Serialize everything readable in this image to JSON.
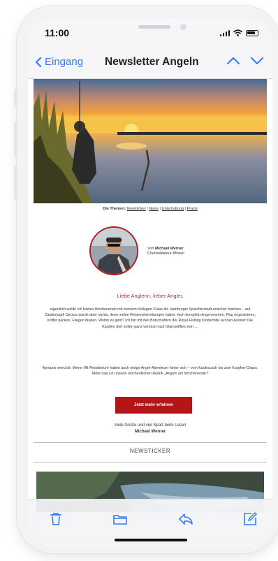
{
  "status": {
    "time": "11:00"
  },
  "nav": {
    "back_label": "Eingang",
    "title": "Newsletter Angeln"
  },
  "mail": {
    "topics": {
      "prefix": "Die Themen:",
      "links": [
        "Newsticker",
        "News",
        "Unterhaltung",
        "Praxis"
      ],
      "separator": " | "
    },
    "author": {
      "von": "Von",
      "name": "Michael Werner",
      "role": "Chefredakteur Blinker"
    },
    "greeting": "Liebe Anglerin, lieber Angler,",
    "paragraph1": "eigentlich wollte ich letztes Wochenende mit meinem Kollegen Claas die Hamburger Speicherstadt unsicher machen – auf Zanderjagd! Daraus wurde aber nichts, denn meine Reisevorbereitungen haben mich komplett eingenommen: Flug organisieren, Koffer packen, Fliegen binden. Wohin es geht? Ich bin mit den Botschaftern der Royal Fishing Kinderhilfe auf den Azoren! Die Karpfen dort sollen ganz verrückt nach Damselflies sein …",
    "paragraph2": "Apropos verrückt: Meine Mit-Redakteure haben auch einige Angel-Abenteuer hinter sich – vom Kaufrausch bis zum Karpfen-Chaos. Mehr dazu in unserer wöchentlichen Rubrik „Angeln am Wochenende“!",
    "cta_label": "Jetzt mehr erfahren",
    "regards": "Viele Grüße und viel Spaß beim Lesen",
    "signature": "Michael Werner",
    "section_title": "NEWSTICKER"
  },
  "toolbar": {
    "icons": [
      "trash-icon",
      "folder-icon",
      "reply-icon",
      "compose-icon"
    ]
  },
  "colors": {
    "accent": "#2f7cf6",
    "brand_red": "#b51515"
  }
}
